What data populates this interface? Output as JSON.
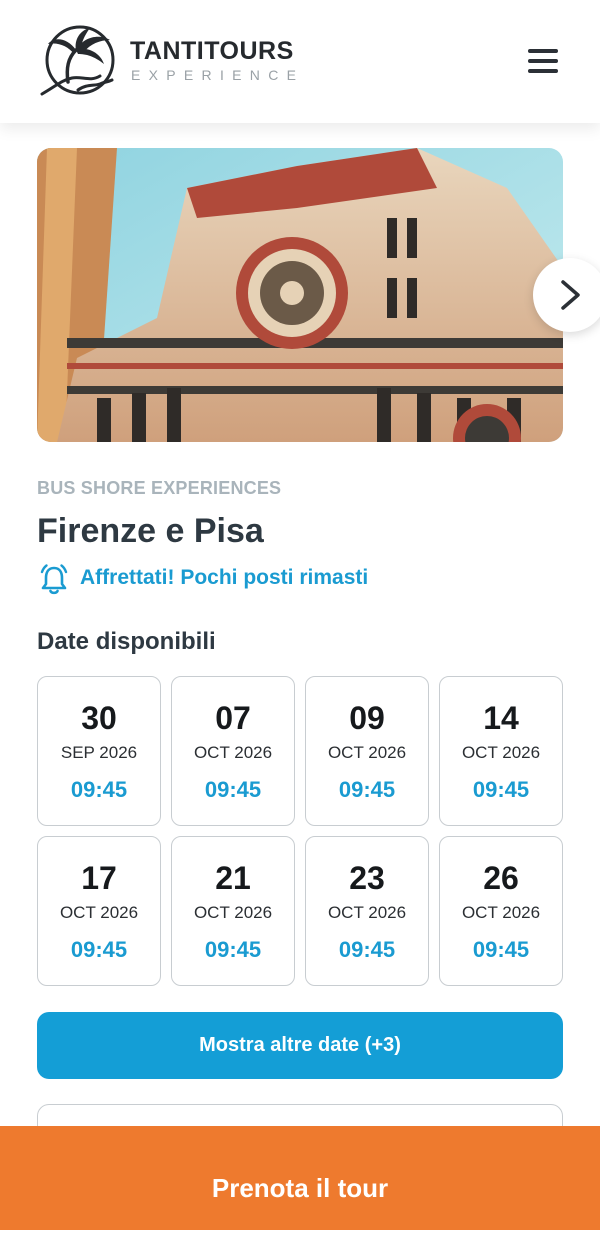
{
  "brand": {
    "name": "TANTITOURS",
    "tagline": "EXPERIENCE",
    "logo_icon": "palm-tree-wave-logo"
  },
  "header": {
    "menu_icon": "hamburger-menu-icon"
  },
  "hero": {
    "image": "florence-cathedral-facade",
    "next_icon": "chevron-right-icon"
  },
  "tour": {
    "category": "BUS SHORE EXPERIENCES",
    "title": "Firenze e Pisa",
    "alert_icon": "bell-icon",
    "alert_text": "Affrettati! Pochi posti rimasti"
  },
  "dates": {
    "title": "Date disponibili",
    "items": [
      {
        "day": "30",
        "month": "SEP 2026",
        "time": "09:45"
      },
      {
        "day": "07",
        "month": "OCT 2026",
        "time": "09:45"
      },
      {
        "day": "09",
        "month": "OCT 2026",
        "time": "09:45"
      },
      {
        "day": "14",
        "month": "OCT 2026",
        "time": "09:45"
      },
      {
        "day": "17",
        "month": "OCT 2026",
        "time": "09:45"
      },
      {
        "day": "21",
        "month": "OCT 2026",
        "time": "09:45"
      },
      {
        "day": "23",
        "month": "OCT 2026",
        "time": "09:45"
      },
      {
        "day": "26",
        "month": "OCT 2026",
        "time": "09:45"
      }
    ],
    "more_label": "Mostra altre date (+3)"
  },
  "booking": {
    "cta_label": "Prenota il tour"
  },
  "colors": {
    "accent_blue": "#149ed6",
    "cta_orange": "#ee7a2e",
    "heading": "#2e3942",
    "muted": "#a9b4bb"
  }
}
